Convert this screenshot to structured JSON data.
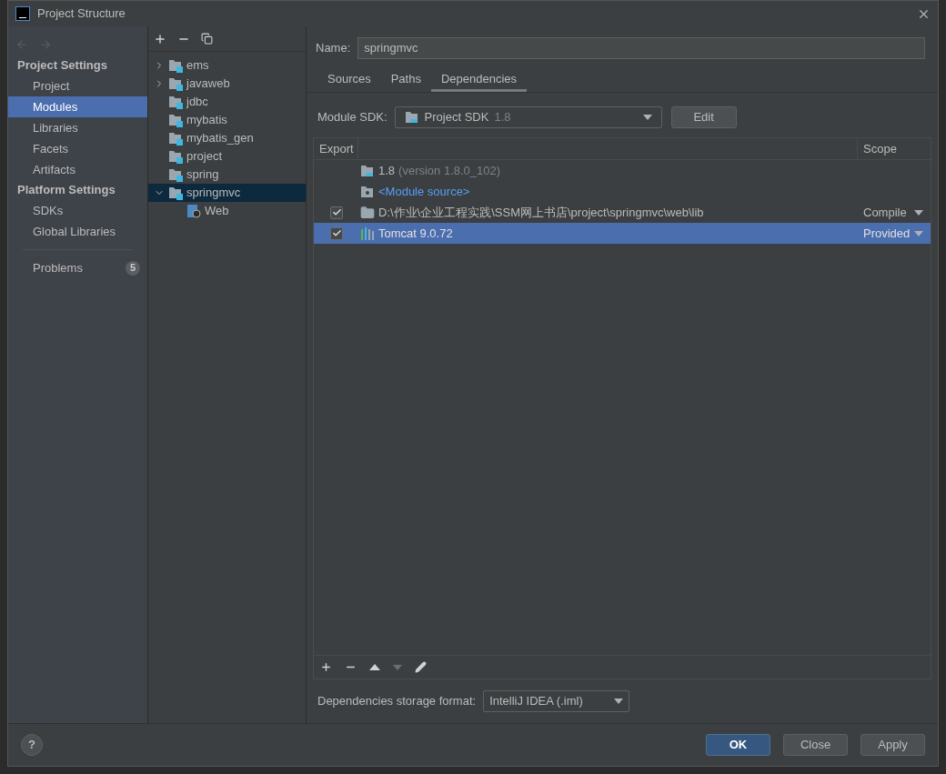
{
  "window": {
    "title": "Project Structure"
  },
  "sidebar": {
    "sections": [
      {
        "header": "Project Settings",
        "items": [
          {
            "label": "Project",
            "selected": false
          },
          {
            "label": "Modules",
            "selected": true
          },
          {
            "label": "Libraries",
            "selected": false
          },
          {
            "label": "Facets",
            "selected": false
          },
          {
            "label": "Artifacts",
            "selected": false
          }
        ]
      },
      {
        "header": "Platform Settings",
        "items": [
          {
            "label": "SDKs",
            "selected": false
          },
          {
            "label": "Global Libraries",
            "selected": false
          }
        ]
      }
    ],
    "problems": {
      "label": "Problems",
      "count": "5"
    }
  },
  "modules": {
    "tree": [
      {
        "label": "ems",
        "kind": "module",
        "expanded": false,
        "selected": false
      },
      {
        "label": "javaweb",
        "kind": "module",
        "expanded": false,
        "selected": false
      },
      {
        "label": "jdbc",
        "kind": "module",
        "selected": false
      },
      {
        "label": "mybatis",
        "kind": "module",
        "selected": false
      },
      {
        "label": "mybatis_gen",
        "kind": "module",
        "selected": false
      },
      {
        "label": "project",
        "kind": "module",
        "selected": false
      },
      {
        "label": "spring",
        "kind": "module",
        "selected": false
      },
      {
        "label": "springmvc",
        "kind": "module",
        "expanded": true,
        "selected": true,
        "children": [
          {
            "label": "Web",
            "kind": "facet",
            "selected": false
          }
        ]
      }
    ]
  },
  "detail": {
    "name_label": "Name:",
    "name_value": "springmvc",
    "tabs": [
      {
        "label": "Sources",
        "selected": false
      },
      {
        "label": "Paths",
        "selected": false
      },
      {
        "label": "Dependencies",
        "selected": true
      }
    ],
    "sdk": {
      "label": "Module SDK:",
      "value": "Project SDK",
      "version": "1.8",
      "edit": "Edit"
    },
    "table": {
      "columns": [
        "Export",
        "Scope"
      ],
      "rows": [
        {
          "kind": "sdk",
          "name": "1.8",
          "detail": "(version 1.8.0_102)",
          "selected": false
        },
        {
          "kind": "source",
          "name": "<Module source>",
          "selected": false
        },
        {
          "kind": "folder",
          "checked": true,
          "name": "D:\\作业\\企业工程实践\\SSM网上书店\\project\\springmvc\\web\\lib",
          "scope": "Compile",
          "selected": false
        },
        {
          "kind": "library",
          "checked": true,
          "name": "Tomcat 9.0.72",
          "scope": "Provided",
          "selected": true
        }
      ]
    },
    "storage": {
      "label": "Dependencies storage format:",
      "value": "IntelliJ IDEA (.iml)"
    }
  },
  "help": "?",
  "buttons": [
    {
      "label": "OK",
      "kind": "primary"
    },
    {
      "label": "Close",
      "kind": "normal"
    },
    {
      "label": "Apply",
      "kind": "normal"
    }
  ]
}
